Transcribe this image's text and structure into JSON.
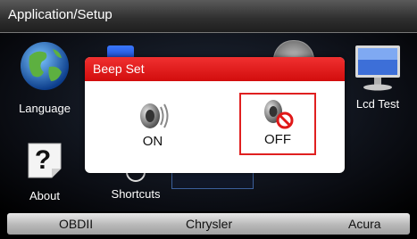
{
  "header": {
    "title": "Application/Setup"
  },
  "tiles": [
    {
      "label": "Language",
      "icon": "globe-icon"
    },
    {
      "label": "Lcd Test",
      "icon": "monitor-icon"
    },
    {
      "label": "About",
      "icon": "question-mark-icon"
    },
    {
      "label": "Shortcuts",
      "icon": "shortcut-icon"
    }
  ],
  "bottom_bar": {
    "items": [
      "OBDII",
      "Chrysler",
      "Acura"
    ]
  },
  "dialog": {
    "title": "Beep Set",
    "options": [
      {
        "label": "ON",
        "icon": "speaker-on-icon",
        "selected": false
      },
      {
        "label": "OFF",
        "icon": "speaker-muted-icon",
        "selected": true
      }
    ]
  },
  "colors": {
    "dialog_header": "#e01818",
    "selection_border": "#e02020",
    "bottom_bar": "#c8c8c8"
  }
}
